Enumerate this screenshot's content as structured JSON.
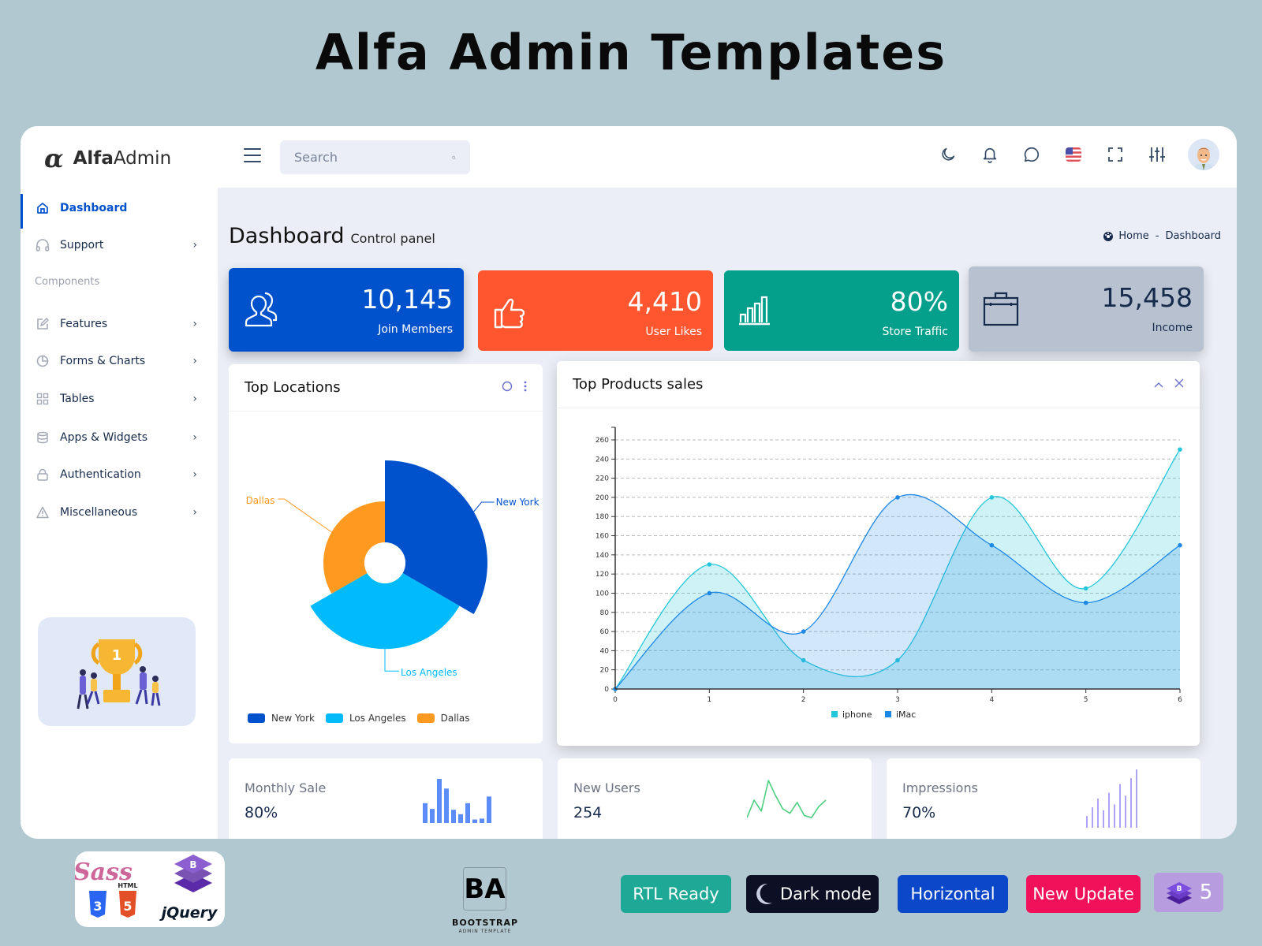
{
  "promo": {
    "title": "Alfa Admin Templates",
    "badges": [
      {
        "label": "RTL Ready",
        "color": "#1ea896"
      },
      {
        "label": "Dark mode",
        "color": "#0d1024"
      },
      {
        "label": "Horizontal",
        "color": "#0a47c9"
      },
      {
        "label": "New Update",
        "color": "#f0115a"
      },
      {
        "label": "5",
        "color": "#b79ce0"
      }
    ],
    "bootstrap_logo": {
      "mark": "BA",
      "title": "BOOTSTRAP",
      "subtitle": "ADMIN TEMPLATE"
    },
    "tech_logos": [
      "Sass",
      "CSS3",
      "HTML5",
      "Bootstrap",
      "jQuery"
    ]
  },
  "header": {
    "logo_alpha": "α",
    "logo_bold": "Alfa",
    "logo_light": "Admin",
    "search_placeholder": "Search",
    "icons": [
      "moon-icon",
      "bell-icon",
      "chat-icon",
      "us-flag-icon",
      "fullscreen-icon",
      "settings-sliders-icon",
      "user-avatar"
    ]
  },
  "sidebar": {
    "items": [
      {
        "label": "Dashboard",
        "icon": "home-icon",
        "active": true
      },
      {
        "label": "Support",
        "icon": "headphones-icon",
        "has_children": true
      }
    ],
    "section_label": "Components",
    "component_items": [
      {
        "label": "Features",
        "icon": "edit-icon"
      },
      {
        "label": "Forms & Charts",
        "icon": "pie-chart-icon"
      },
      {
        "label": "Tables",
        "icon": "grid-icon"
      },
      {
        "label": "Apps & Widgets",
        "icon": "database-icon"
      },
      {
        "label": "Authentication",
        "icon": "lock-icon"
      },
      {
        "label": "Miscellaneous",
        "icon": "warning-icon"
      }
    ],
    "chevron": "›"
  },
  "page": {
    "title": "Dashboard",
    "subtitle": "Control panel",
    "breadcrumb": {
      "home": "Home",
      "sep": "-",
      "current": "Dashboard"
    }
  },
  "stats": [
    {
      "value": "10,145",
      "label": "Join Members",
      "icon": "users-icon",
      "color": "#0052cc"
    },
    {
      "value": "4,410",
      "label": "User Likes",
      "icon": "thumbs-up-icon",
      "color": "#ff562f"
    },
    {
      "value": "80%",
      "label": "Store Traffic",
      "icon": "bar-chart-icon",
      "color": "#04a08b"
    },
    {
      "value": "15,458",
      "label": "Income",
      "icon": "briefcase-icon",
      "color": "#b7c1d0"
    }
  ],
  "locations": {
    "title": "Top Locations"
  },
  "sales": {
    "title": "Top Products sales"
  },
  "minis": [
    {
      "title": "Monthly Sale",
      "value": "80%",
      "color": "#5b8cf7",
      "kind": "bar",
      "points": [
        45,
        32,
        100,
        78,
        30,
        20,
        45,
        8,
        10,
        60
      ]
    },
    {
      "title": "New Users",
      "value": "254",
      "color": "#4ccf7f",
      "kind": "line",
      "points": [
        5,
        45,
        20,
        90,
        55,
        25,
        15,
        40,
        10,
        5,
        30,
        45
      ]
    },
    {
      "title": "Impressions",
      "value": "70%",
      "color": "#8a7cf2",
      "kind": "spike",
      "points": [
        20,
        35,
        50,
        30,
        60,
        40,
        75,
        55,
        85,
        100
      ]
    }
  ],
  "chart_data": [
    {
      "type": "pie",
      "subtype": "nightingale-rose",
      "title": "Top Locations",
      "categories": [
        "New York",
        "Los Angeles",
        "Dallas"
      ],
      "values": [
        100,
        80,
        50
      ],
      "colors": [
        "#0052cc",
        "#00bafe",
        "#ff9920"
      ],
      "legend": "bottom-left",
      "labels": [
        "New York",
        "Los Angeles",
        "Dallas"
      ]
    },
    {
      "type": "area",
      "title": "Top Products sales",
      "x": [
        0,
        1,
        2,
        3,
        4,
        5,
        6
      ],
      "series": [
        {
          "name": "iphone",
          "values": [
            0,
            130,
            30,
            30,
            200,
            105,
            250
          ],
          "color": "#26c6da"
        },
        {
          "name": "iMac",
          "values": [
            0,
            100,
            60,
            200,
            150,
            90,
            150
          ],
          "color": "#1e88e5"
        }
      ],
      "ylim": [
        0,
        260
      ],
      "yticks": [
        0,
        20,
        40,
        60,
        80,
        100,
        120,
        140,
        160,
        180,
        200,
        220,
        240,
        260
      ],
      "grid": true,
      "legend": "bottom-center",
      "xlabel": "",
      "ylabel": ""
    }
  ]
}
